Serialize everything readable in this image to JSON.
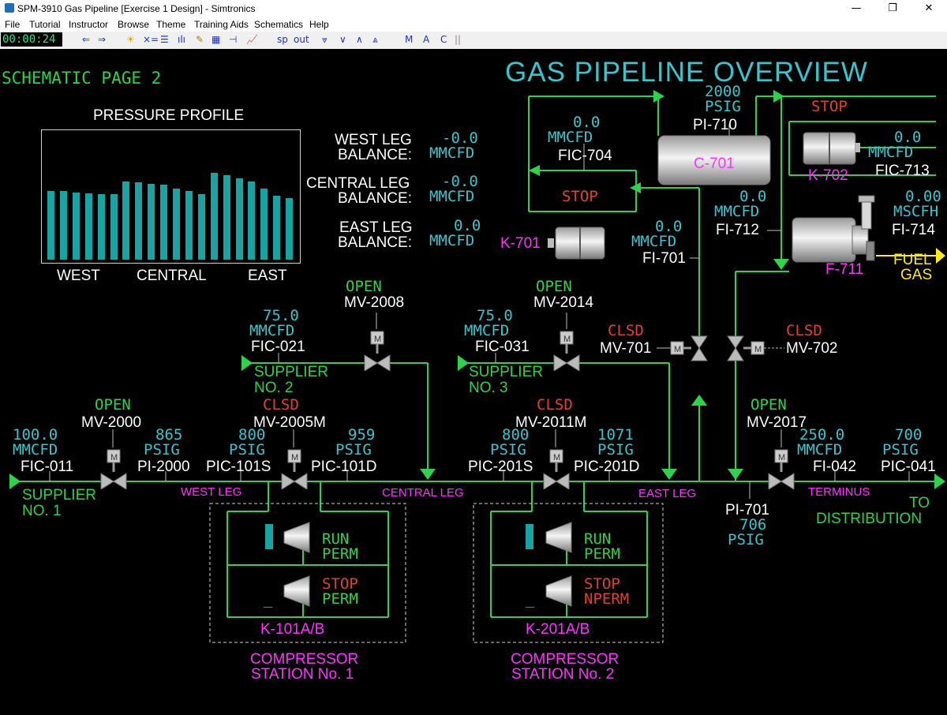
{
  "window": {
    "title": "SPM-3910 Gas Pipeline [Exercise 1 Design] - Simtronics",
    "minimize": "—",
    "restore": "❐",
    "close": "✕"
  },
  "menu": [
    "File",
    "Tutorial",
    "Instructor",
    "Browse",
    "Theme",
    "Training Aids",
    "Schematics",
    "Help"
  ],
  "toolbar": {
    "clock": "00:00:24",
    "sp": "sp",
    "out": "out",
    "m": "M",
    "a": "A",
    "c": "C"
  },
  "page": {
    "label": "SCHEMATIC  PAGE  2",
    "title": "GAS PIPELINE OVERVIEW"
  },
  "profile": {
    "title": "PRESSURE PROFILE",
    "west": "WEST",
    "central": "CENTRAL",
    "east": "EAST",
    "bars": [
      0.58,
      0.58,
      0.57,
      0.56,
      0.55,
      0.55,
      0.66,
      0.65,
      0.64,
      0.63,
      0.6,
      0.58,
      0.55,
      0.73,
      0.71,
      0.69,
      0.66,
      0.6,
      0.54,
      0.52
    ]
  },
  "balance": {
    "west": {
      "line1": "WEST LEG",
      "line2": "BALANCE:",
      "value": "-0.0",
      "unit": "MMCFD"
    },
    "central": {
      "line1": "CENTRAL LEG",
      "line2": "BALANCE:",
      "value": "-0.0",
      "unit": "MMCFD"
    },
    "east": {
      "line1": "EAST LEG",
      "line2": "BALANCE:",
      "value": "0.0",
      "unit": "MMCFD"
    }
  },
  "compressors": {
    "k701": {
      "tag": "K-701",
      "status": "STOP"
    },
    "c701": {
      "tag": "C-701"
    },
    "k702": {
      "tag": "K-702",
      "status": "STOP"
    },
    "f711": {
      "tag": "F-711"
    }
  },
  "instruments": {
    "pi710": {
      "value": "2000",
      "unit": "PSIG",
      "tag": "PI-710"
    },
    "fic704": {
      "value": "0.0",
      "unit": "MMCFD",
      "tag": "FIC-704"
    },
    "fic713": {
      "value": "0.0",
      "unit": "MMCFD",
      "tag": "FIC-713"
    },
    "fi712": {
      "value": "0.0",
      "unit": "MMCFD",
      "tag": "FI-712"
    },
    "fi714": {
      "value": "0.00",
      "unit": "MSCFH",
      "tag": "FI-714"
    },
    "fi701": {
      "value": "0.0",
      "unit": "MMCFD",
      "tag": "FI-701"
    },
    "fic021": {
      "value": "75.0",
      "unit": "MMCFD",
      "tag": "FIC-021"
    },
    "fic031": {
      "value": "75.0",
      "unit": "MMCFD",
      "tag": "FIC-031"
    },
    "fic011": {
      "value": "100.0",
      "unit": "MMCFD",
      "tag": "FIC-011"
    },
    "pi2000": {
      "value": "865",
      "unit": "PSIG",
      "tag": "PI-2000"
    },
    "pic101s": {
      "value": "800",
      "unit": "PSIG",
      "tag": "PIC-101S"
    },
    "pic101d": {
      "value": "959",
      "unit": "PSIG",
      "tag": "PIC-101D"
    },
    "pic201s": {
      "value": "800",
      "unit": "PSIG",
      "tag": "PIC-201S"
    },
    "pic201d": {
      "value": "1071",
      "unit": "PSIG",
      "tag": "PIC-201D"
    },
    "fi042": {
      "value": "250.0",
      "unit": "MMCFD",
      "tag": "FI-042"
    },
    "pic041": {
      "value": "700",
      "unit": "PSIG",
      "tag": "PIC-041"
    },
    "pi701": {
      "tag": "PI-701",
      "value": "706",
      "unit": "PSIG"
    }
  },
  "valves": {
    "mv2008": {
      "tag": "MV-2008",
      "status": "OPEN"
    },
    "mv2014": {
      "tag": "MV-2014",
      "status": "OPEN"
    },
    "mv701": {
      "tag": "MV-701",
      "status": "CLSD"
    },
    "mv702": {
      "tag": "MV-702",
      "status": "CLSD"
    },
    "mv2000": {
      "tag": "MV-2000",
      "status": "OPEN"
    },
    "mv2005m": {
      "tag": "MV-2005M",
      "status": "CLSD"
    },
    "mv2011m": {
      "tag": "MV-2011M",
      "status": "CLSD"
    },
    "mv2017": {
      "tag": "MV-2017",
      "status": "OPEN"
    },
    "m": "M"
  },
  "labels": {
    "fuel": "FUEL",
    "gas": "GAS",
    "supplier1a": "SUPPLIER",
    "supplier1b": "NO. 1",
    "supplier2a": "SUPPLIER",
    "supplier2b": "NO. 2",
    "supplier3a": "SUPPLIER",
    "supplier3b": "NO. 3",
    "westleg": "WEST LEG",
    "centralleg": "CENTRAL LEG",
    "eastleg": "EAST LEG",
    "terminus": "TERMINUS",
    "toa": "TO",
    "tob": "DISTRIBUTION"
  },
  "stations": {
    "s1": {
      "run1": "RUN",
      "run2": "PERM",
      "stop1": "STOP",
      "stop2": "PERM",
      "tag": "K-101A/B",
      "name1": "COMPRESSOR",
      "name2": "STATION No. 1",
      "cursor": "_"
    },
    "s2": {
      "run1": "RUN",
      "run2": "PERM",
      "stop1": "STOP",
      "stop2": "NPERM",
      "tag": "K-201A/B",
      "name1": "COMPRESSOR",
      "name2": "STATION No. 2",
      "cursor": "_"
    }
  }
}
